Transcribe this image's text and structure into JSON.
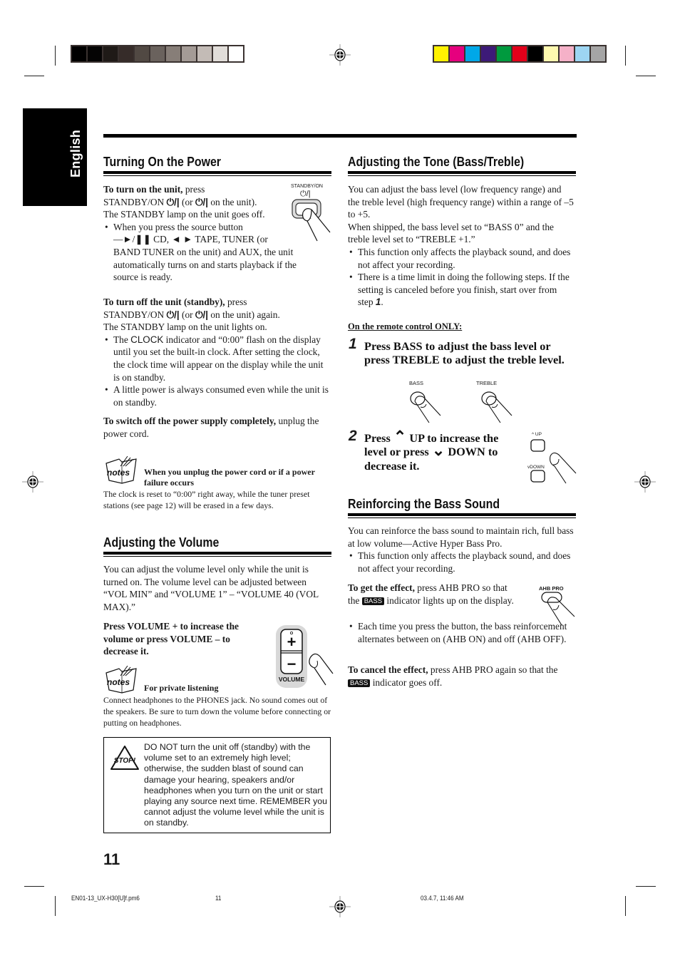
{
  "print_marks": {
    "gray_swatches": [
      "#000000",
      "#050404",
      "#1f1a17",
      "#362c29",
      "#514943",
      "#6a625d",
      "#877e78",
      "#a49b96",
      "#c3bbb6",
      "#e1ddd9",
      "#ffffff"
    ],
    "color_swatches": [
      "#fff200",
      "#e6007e",
      "#00a8e8",
      "#3d1a78",
      "#009a3e",
      "#e2001a",
      "#000000",
      "#fff9b0",
      "#f5b1c8",
      "#9dd5f2",
      "#a5a5a5"
    ]
  },
  "language_tab": "English",
  "left": {
    "power": {
      "heading": "Turning On the Power",
      "standby_label": "STANDBY/ON",
      "standby_symbol": "⏻/|",
      "turn_on_lead": "To turn on the unit,",
      "turn_on_line1": " press",
      "turn_on_line2a": "STANDBY/ON ",
      "symbol": "⏻/|",
      "turn_on_line2b": " (or ",
      "turn_on_line2c": " on the unit).",
      "turn_on_line3": "The STANDBY lamp on the unit goes off.",
      "bullet1_line1": "When you press the source button",
      "bullet1_line2": "—►/❚❚ CD, ◄ ► TAPE, TUNER (or",
      "bullet1_line3": "BAND TUNER on the unit) and AUX, the unit",
      "bullet1_line4": "automatically turns on and starts playback if the",
      "bullet1_line5": "source is ready.",
      "turn_off_lead": "To turn off the unit (standby),",
      "turn_off_line1": " press",
      "turn_off_line2a": "STANDBY/ON ",
      "turn_off_line2b": " (or ",
      "turn_off_line2c": " on the unit) again.",
      "turn_off_line3": "The STANDBY lamp on the unit lights on.",
      "bullet2_a": "The ",
      "bullet2_clock": "CLOCK",
      "bullet2_b": " indicator and “0:00” flash on the display until you set the built-in clock. After setting the clock, the clock time will appear on the display while the unit is on standby.",
      "bullet3": "A little power is always consumed even while the unit is on standby.",
      "switch_off_lead": "To switch off the power supply completely,",
      "switch_off_rest": " unplug the power cord.",
      "notes_label": "notes",
      "notes_title": "When you unplug the power cord or if a power failure occurs",
      "notes_body": "The clock is reset to “0:00” right away, while the tuner preset stations (see page 12) will be erased in a few days."
    },
    "volume": {
      "heading": "Adjusting the Volume",
      "intro": "You can adjust the volume level only while the unit is turned on. The volume level can be adjusted between “VOL MIN” and “VOLUME 1” – “VOLUME 40 (VOL MAX).”",
      "instruction": "Press VOLUME + to increase the volume or press VOLUME – to decrease it.",
      "button_label": "VOLUME",
      "plus": "+",
      "minus": "−",
      "notes_label": "notes",
      "notes_title": "For private listening",
      "notes_body": "Connect headphones to the PHONES jack. No sound comes out of the speakers. Be sure to turn down the volume before connecting or putting on headphones.",
      "stop_label": "STOP!",
      "warning": "DO NOT turn the unit off (standby) with the volume set to an extremely high level; otherwise, the sudden blast of sound can damage your hearing, speakers and/or headphones when you turn on the unit or start playing any source next time. REMEMBER you cannot adjust the volume level while the unit is on standby."
    }
  },
  "right": {
    "tone": {
      "heading": "Adjusting the Tone (Bass/Treble)",
      "intro": "You can adjust the bass level (low frequency range) and the treble level (high frequency range) within a range of –5 to +5.",
      "shipped": "When shipped, the bass level set to “BASS 0” and the treble level set to “TREBLE +1.”",
      "bullet1": "This function only affects the playback sound, and does not affect your recording.",
      "bullet2_a": "There is a time limit in doing the following steps. If the setting is canceled before you finish, start over from step ",
      "bullet2_step": "1",
      "bullet2_end": ".",
      "remote_only": "On the remote control ONLY:",
      "step1_num": "1",
      "step1_text": "Press BASS to adjust the bass level or press TREBLE to adjust the treble level.",
      "bass_label": "BASS",
      "treble_label": "TREBLE",
      "step2_num": "2",
      "step2_a": "Press ",
      "step2_up_icon": "⌃",
      "step2_b": " UP to increase the level or press ",
      "step2_down_icon": "⌄",
      "step2_c": " DOWN to decrease it.",
      "up_label": "UP",
      "down_label": "DOWN"
    },
    "bass": {
      "heading": "Reinforcing the Bass Sound",
      "intro": "You can reinforce the bass sound to maintain rich, full bass at low volume—Active Hyper Bass Pro.",
      "bullet1": "This function only affects the playback sound, and does not affect your recording.",
      "get_lead": "To get the effect,",
      "get_rest_a": " press AHB PRO so that the ",
      "badge": "BASS",
      "get_rest_b": " indicator lights up on the display.",
      "bullet2": "Each time you press the button, the bass reinforcement alternates between on (AHB ON) and off (AHB OFF).",
      "cancel_lead": "To cancel the effect,",
      "cancel_rest_a": " press AHB PRO again so that the ",
      "cancel_rest_b": " indicator goes off.",
      "button_label": "AHB PRO"
    }
  },
  "page_number": "11",
  "footer": {
    "file": "EN01-13_UX-H30[U]f.pm6",
    "page": "11",
    "timestamp": "03.4.7, 11:46 AM"
  }
}
